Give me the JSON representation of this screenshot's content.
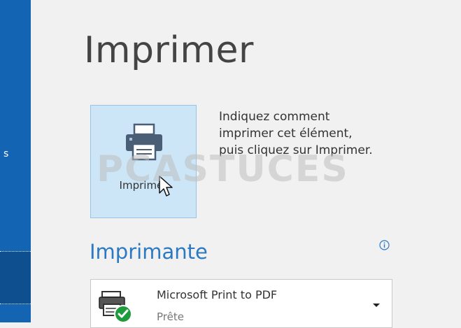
{
  "nav": {
    "partial_label": "s"
  },
  "page": {
    "title": "Imprimer"
  },
  "print_button": {
    "label": "Imprimer"
  },
  "instructions": {
    "lines": [
      "Indiquez comment",
      "imprimer cet élément,",
      "puis cliquez sur Imprimer."
    ]
  },
  "watermark": {
    "text": "PCASTUCES"
  },
  "printer_section": {
    "title": "Imprimante"
  },
  "printer_select": {
    "name": "Microsoft Print to PDF",
    "status": "Prête"
  },
  "icons": {
    "printer": "printer-icon",
    "cursor": "mouse-pointer-icon",
    "info": "info-icon",
    "pdf_printer": "pdf-printer-icon",
    "ready_check": "check-icon",
    "dropdown": "chevron-down-icon"
  },
  "colors": {
    "nav_bar": "#1464b4",
    "accent": "#2b79c2",
    "button_bg": "#cde6f7",
    "ready_green": "#1e9b3c"
  }
}
